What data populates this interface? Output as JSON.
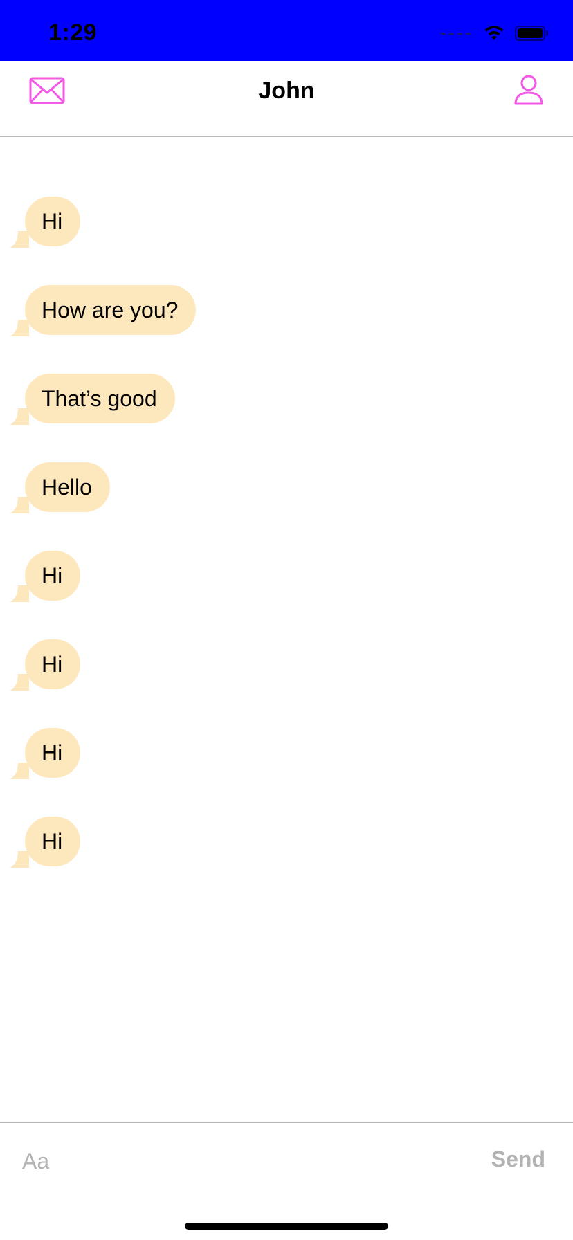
{
  "status_bar": {
    "time": "1:29",
    "background_color": "#0000ff"
  },
  "nav": {
    "title": "John",
    "left_icon": "mail-icon",
    "right_icon": "person-icon",
    "accent_color": "#f25ae6"
  },
  "messages": [
    {
      "text": "Hi"
    },
    {
      "text": "How are you?"
    },
    {
      "text": "That’s good"
    },
    {
      "text": "Hello"
    },
    {
      "text": "Hi"
    },
    {
      "text": "Hi"
    },
    {
      "text": "Hi"
    },
    {
      "text": "Hi"
    }
  ],
  "bubble_color": "#fde7bd",
  "composer": {
    "placeholder": "Aa",
    "send_label": "Send"
  }
}
